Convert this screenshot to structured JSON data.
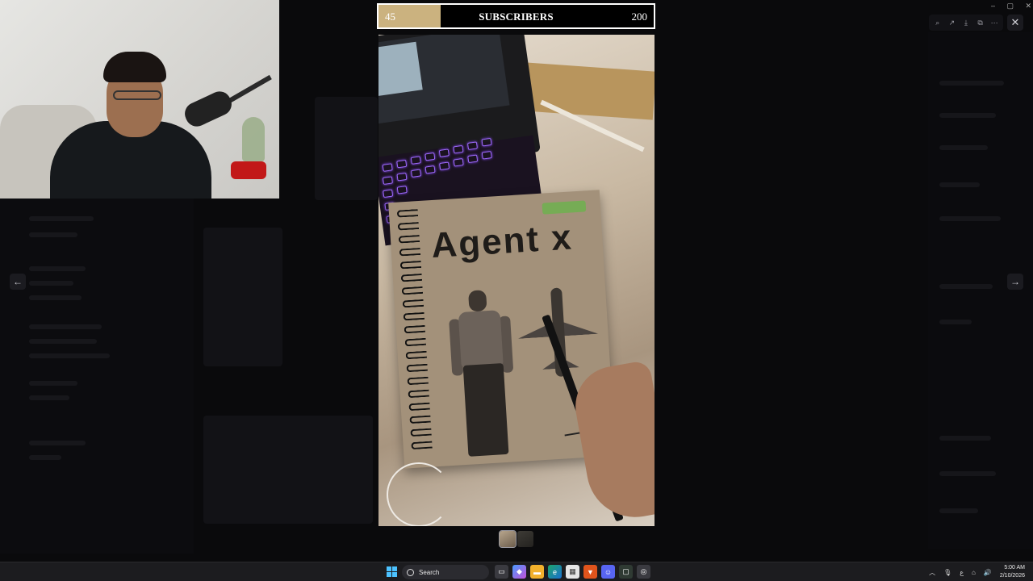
{
  "subscriber_goal": {
    "current": "45",
    "label": "SUBSCRIBERS",
    "goal": "200",
    "progress_fraction": 0.225,
    "fill_color": "#cbb27f"
  },
  "image_viewer": {
    "photo": {
      "notebook_title": "Agent x"
    },
    "thumbnails": [
      {
        "name": "thumbnail-1",
        "active": true
      },
      {
        "name": "thumbnail-2",
        "active": false
      }
    ],
    "toolbar": {
      "icons": [
        "zoom-icon",
        "share-icon",
        "download-icon",
        "open-external-icon",
        "more-icon"
      ],
      "close_icon": "close-icon"
    },
    "nav": {
      "prev_icon": "arrow-left-icon",
      "next_icon": "arrow-right-icon"
    }
  },
  "taskbar": {
    "search_label": "Search",
    "apps": [
      "task-view",
      "copilot",
      "file-explorer",
      "edge",
      "store",
      "brave",
      "discord",
      "xbox",
      "chrome"
    ],
    "clock": {
      "time": "5:00 AM",
      "date": "2/10/2026"
    },
    "accent_color": "#4cc2ff"
  }
}
